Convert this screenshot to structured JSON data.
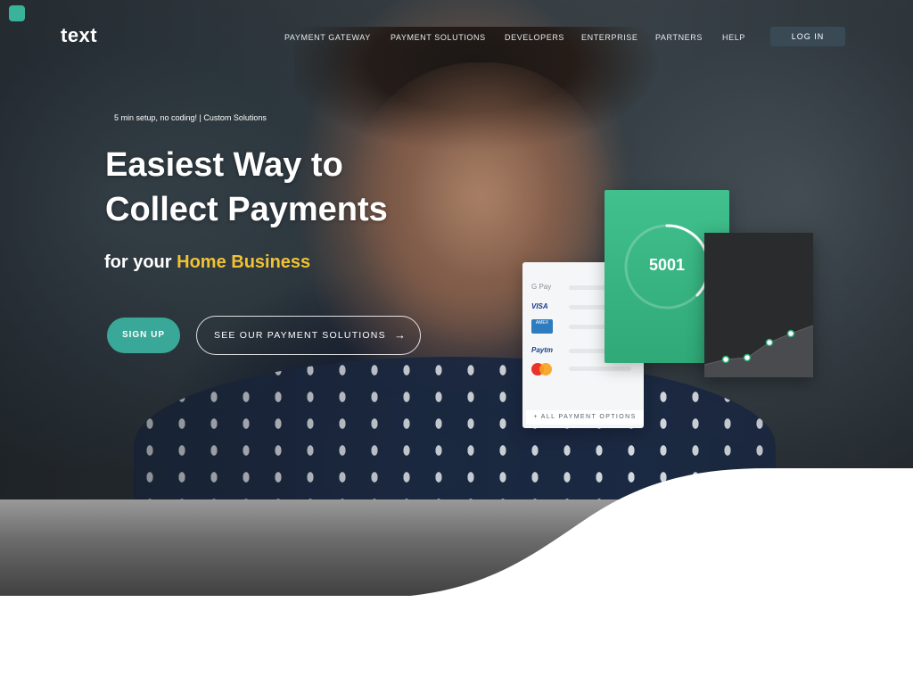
{
  "brand": {
    "name": "text"
  },
  "nav": {
    "items": [
      "PAYMENT GATEWAY",
      "PAYMENT SOLUTIONS",
      "DEVELOPERS",
      "ENTERPRISE",
      "PARTNERS",
      "HELP"
    ],
    "login_label": "LOG IN"
  },
  "hero": {
    "tagline": "5 min setup, no coding! | Custom Solutions",
    "headline_line1": "Easiest Way to",
    "headline_line2": "Collect Payments",
    "subline_prefix": "for your",
    "subline_highlight": "Home Business",
    "signup_label": "SIGN UP",
    "solutions_label": "SEE OUR PAYMENT SOLUTIONS",
    "solutions_arrow": "→"
  },
  "illustration": {
    "payment_methods": [
      "G Pay",
      "VISA",
      "AMEX",
      "Paytm",
      "Mastercard"
    ],
    "all_options_label": "+ ALL PAYMENT OPTIONS",
    "counter_value": "5001",
    "colors": {
      "accent_green": "#39a898",
      "card_green": "#41c08e",
      "highlight_yellow": "#f1c232",
      "card_dark": "#2a2b2d"
    }
  },
  "icons": {
    "arrow": "arrow-right-icon",
    "logo": "brand-logo-icon"
  }
}
